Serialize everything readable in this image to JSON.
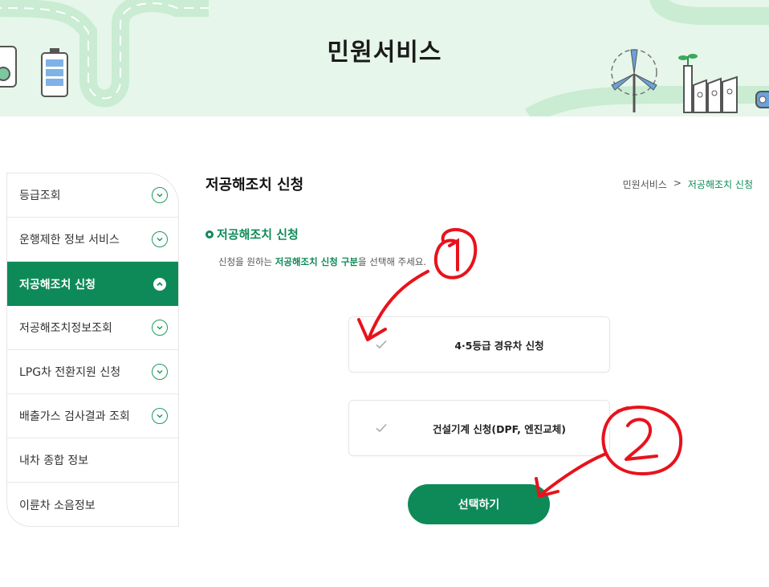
{
  "header": {
    "title": "민원서비스"
  },
  "sidebar": {
    "items": [
      {
        "label": "등급조회",
        "active": false
      },
      {
        "label": "운행제한 정보 서비스",
        "active": false
      },
      {
        "label": "저공해조치 신청",
        "active": true
      },
      {
        "label": "저공해조치정보조회",
        "active": false
      },
      {
        "label": "LPG차 전환지원 신청",
        "active": false
      },
      {
        "label": "배출가스 검사결과 조회",
        "active": false
      },
      {
        "label": "내차 종합 정보",
        "active": false
      },
      {
        "label": "이륜차 소음정보",
        "active": false
      }
    ]
  },
  "main": {
    "page_title": "저공해조치 신청",
    "breadcrumb": [
      "민원서비스",
      ">",
      "저공해조치 신청"
    ],
    "section_title": "저공해조치 신청",
    "instruction": {
      "prefix": "신청을 원하는 ",
      "highlight": "저공해조치 신청 구분",
      "suffix": "을 선택해 주세요."
    },
    "options": [
      {
        "label": "4·5등급 경유차 신청"
      },
      {
        "label": "건설기계 신청(DPF, 엔진교체)"
      }
    ],
    "select_button": "선택하기"
  },
  "annotations": {
    "marks": [
      "①",
      "②"
    ],
    "color": "#e8121c"
  },
  "colors": {
    "accent": "#0e8a58",
    "banner_bg": "#e6f6ea"
  }
}
